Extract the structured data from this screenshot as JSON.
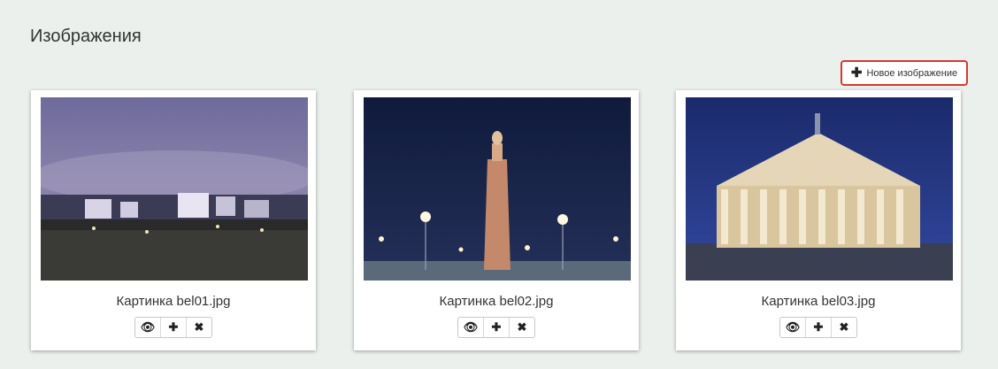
{
  "page": {
    "title": "Изображения"
  },
  "toolbar": {
    "new_image_label": "Новое изображение",
    "new_image_icon": "plus-icon",
    "highlight_color": "#d9382f"
  },
  "cards": [
    {
      "caption": "Картинка bel01.jpg",
      "image": "night-city-panorama",
      "actions": [
        "view-icon",
        "plus-icon",
        "close-icon"
      ]
    },
    {
      "caption": "Картинка bel02.jpg",
      "image": "night-monument-column",
      "actions": [
        "view-icon",
        "plus-icon",
        "close-icon"
      ]
    },
    {
      "caption": "Картинка bel03.jpg",
      "image": "night-colonnade-building",
      "actions": [
        "view-icon",
        "plus-icon",
        "close-icon"
      ]
    }
  ]
}
